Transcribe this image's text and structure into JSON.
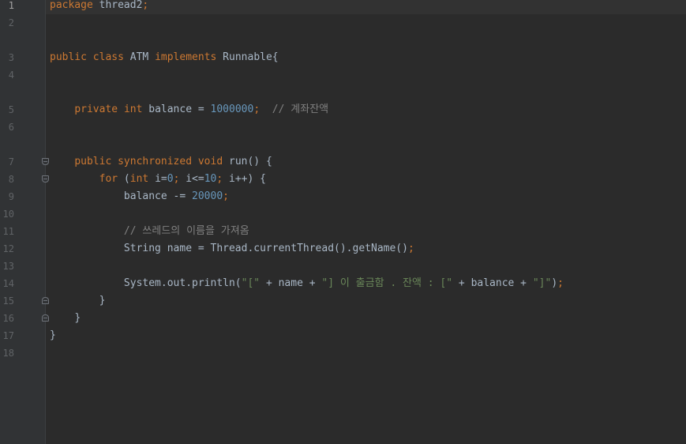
{
  "editor": {
    "current_line": 1,
    "gutter": {
      "lines": [
        "1",
        "2",
        "3",
        "4",
        "5",
        "6",
        "7",
        "8",
        "9",
        "10",
        "11",
        "12",
        "13",
        "14",
        "15",
        "16",
        "17",
        "18"
      ],
      "fold_start_lines": [
        7,
        8
      ],
      "fold_end_lines": [
        15,
        16
      ]
    },
    "code": {
      "l1": {
        "kw_package": "package",
        "name": " thread2",
        "semi": ";"
      },
      "l3": {
        "kw_public": "public",
        "sp1": " ",
        "kw_class": "class",
        "cls": " ATM ",
        "kw_implements": "implements",
        "iface": " Runnable{"
      },
      "l5": {
        "indent": "    ",
        "kw_private": "private",
        "sp1": " ",
        "kw_int": "int",
        "decl": " balance = ",
        "num": "1000000",
        "semi": ";",
        "sp2": "  ",
        "comment": "// 계좌잔액"
      },
      "l7": {
        "indent": "    ",
        "kw_public": "public",
        "sp1": " ",
        "kw_synchronized": "synchronized",
        "sp2": " ",
        "kw_void": "void",
        "rest": " run() {"
      },
      "l8": {
        "indent": "        ",
        "kw_for": "for",
        "p1": " (",
        "kw_int": "int",
        "p2": " i=",
        "n0": "0",
        "s1": ";",
        "p3": " i<=",
        "n10": "10",
        "s2": ";",
        "p4": " i++) {"
      },
      "l9": {
        "indent": "            ",
        "lhs": "balance -= ",
        "num": "20000",
        "semi": ";"
      },
      "l11": {
        "indent": "            ",
        "comment": "// 쓰레드의 이름을 가져옴"
      },
      "l12": {
        "indent": "            ",
        "decl": "String name = Thread.currentThread().getName()",
        "semi": ";"
      },
      "l14": {
        "indent": "            ",
        "call": "System.out.println(",
        "s1": "\"[\"",
        "p1": " + name + ",
        "s2": "\"] 이 출금함 . 잔액 : [\"",
        "p2": " + balance + ",
        "s3": "\"]\"",
        "close": ")",
        "semi": ";"
      },
      "l15": {
        "indent": "        ",
        "brace": "}"
      },
      "l16": {
        "indent": "    ",
        "brace": "}"
      },
      "l17": {
        "brace": "}"
      }
    }
  }
}
